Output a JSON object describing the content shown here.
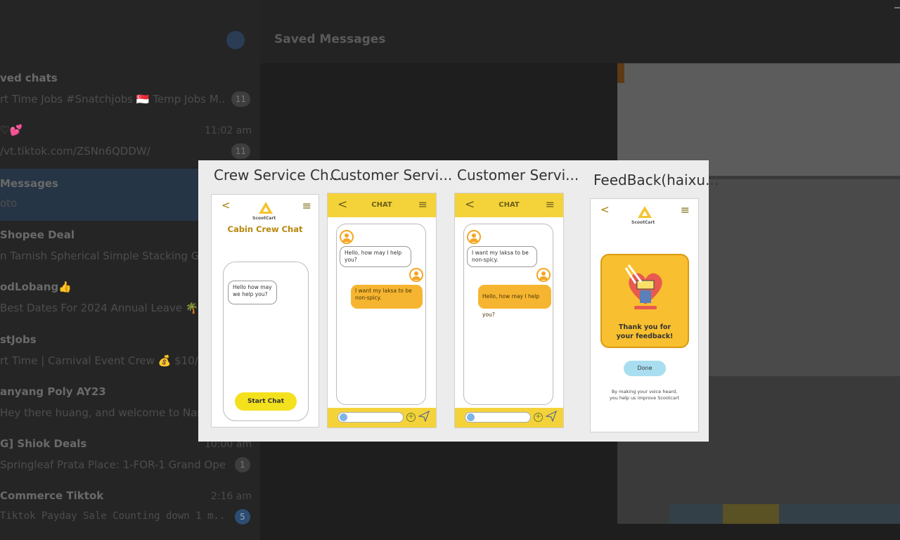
{
  "sidebar": {
    "search_placeholder": "",
    "chats": [
      {
        "name": "ved chats",
        "preview": "rt Time Jobs #Snatchjobs 🇸🇬 Temp Jobs M...",
        "time": "",
        "badge": "11",
        "active": false
      },
      {
        "name": "♡💕",
        "preview": "/vt.tiktok.com/ZSNn6QDDW/",
        "time": "11:02 am",
        "badge": "11",
        "active": false
      },
      {
        "name": "Messages",
        "preview": "oto",
        "time": "",
        "badge": "",
        "active": true
      },
      {
        "name": "Shopee Deal",
        "preview": "n Tarnish Spherical Simple Stacking Go",
        "time": "",
        "badge": "",
        "active": false
      },
      {
        "name": "odLobang👍",
        "preview": "Best Dates For 2024 Annual Leave 🌴",
        "time": "",
        "badge": "",
        "active": false
      },
      {
        "name": "stJobs",
        "preview": "rt Time | Carnival Event Crew 💰 $10/",
        "time": "",
        "badge": "",
        "active": false
      },
      {
        "name": "anyang Poly AY23",
        "preview": "Hey there huang, and welcome to Nan",
        "time": "",
        "badge": "",
        "active": false
      },
      {
        "name": "G] Shiok Deals",
        "preview": "Springleaf Prata Place: 1-FOR-1 Grand Ope...",
        "time": "10:00 am",
        "badge": "1",
        "active": false
      },
      {
        "name": "Commerce Tiktok",
        "preview": "Tiktok Payday Sale Counting down 1 m...",
        "time": "2:16 am",
        "badge": "5",
        "active": false
      }
    ]
  },
  "header": {
    "title": "Saved Messages"
  },
  "modal": {
    "screens": [
      {
        "title": "Crew Service Ch...",
        "logo": "ScootCart",
        "heading": "Cabin Crew Chat",
        "message": "Hello how may we help you?",
        "button": "Start Chat"
      },
      {
        "title": "Customer Servi...",
        "header": "CHAT",
        "msg_in": "Hello, how may I help you?",
        "msg_out": "I want my laksa to be non-spicy."
      },
      {
        "title": "Customer Servi...",
        "header": "CHAT",
        "msg_in": "I want my laksa to be non-spicy.",
        "msg_out": "Hello, how may I help you?"
      },
      {
        "title": "FeedBack(haixu...",
        "logo": "ScootCart",
        "thanks": "Thank you for your feedback!",
        "button": "Done",
        "footer": "By making your voice heard, you help us improve Scootcart"
      }
    ]
  },
  "colors": {
    "accent_yellow": "#f4d33a",
    "bubble_orange": "#f6b531",
    "done_blue": "#a9def0"
  },
  "icons": {
    "back": "<",
    "menu": "≡",
    "plus": "+"
  }
}
